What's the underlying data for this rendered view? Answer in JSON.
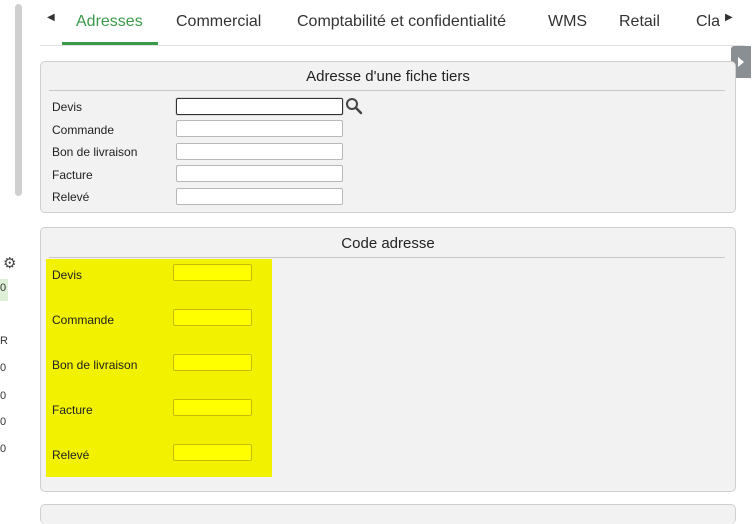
{
  "tabs": {
    "items": [
      {
        "label": "Adresses",
        "active": true
      },
      {
        "label": "Commercial",
        "active": false
      },
      {
        "label": "Comptabilité et confidentialité",
        "active": false
      },
      {
        "label": "WMS",
        "active": false
      },
      {
        "label": "Retail",
        "active": false
      },
      {
        "label": "Cla",
        "active": false
      }
    ],
    "accent_color": "#3a9a4a"
  },
  "left_fragments": [
    "0",
    "R",
    "0",
    "0",
    "0",
    "0"
  ],
  "fiche_tiers": {
    "title": "Adresse d'une fiche tiers",
    "fields": [
      {
        "label": "Devis",
        "value": ""
      },
      {
        "label": "Commande",
        "value": ""
      },
      {
        "label": "Bon de livraison",
        "value": ""
      },
      {
        "label": "Facture",
        "value": ""
      },
      {
        "label": "Relevé",
        "value": ""
      }
    ]
  },
  "code_adresse": {
    "title": "Code adresse",
    "highlight_color": "#f2f200",
    "fields": [
      {
        "label": "Devis",
        "value": ""
      },
      {
        "label": "Commande",
        "value": ""
      },
      {
        "label": "Bon de livraison",
        "value": ""
      },
      {
        "label": "Facture",
        "value": ""
      },
      {
        "label": "Relevé",
        "value": ""
      }
    ]
  }
}
